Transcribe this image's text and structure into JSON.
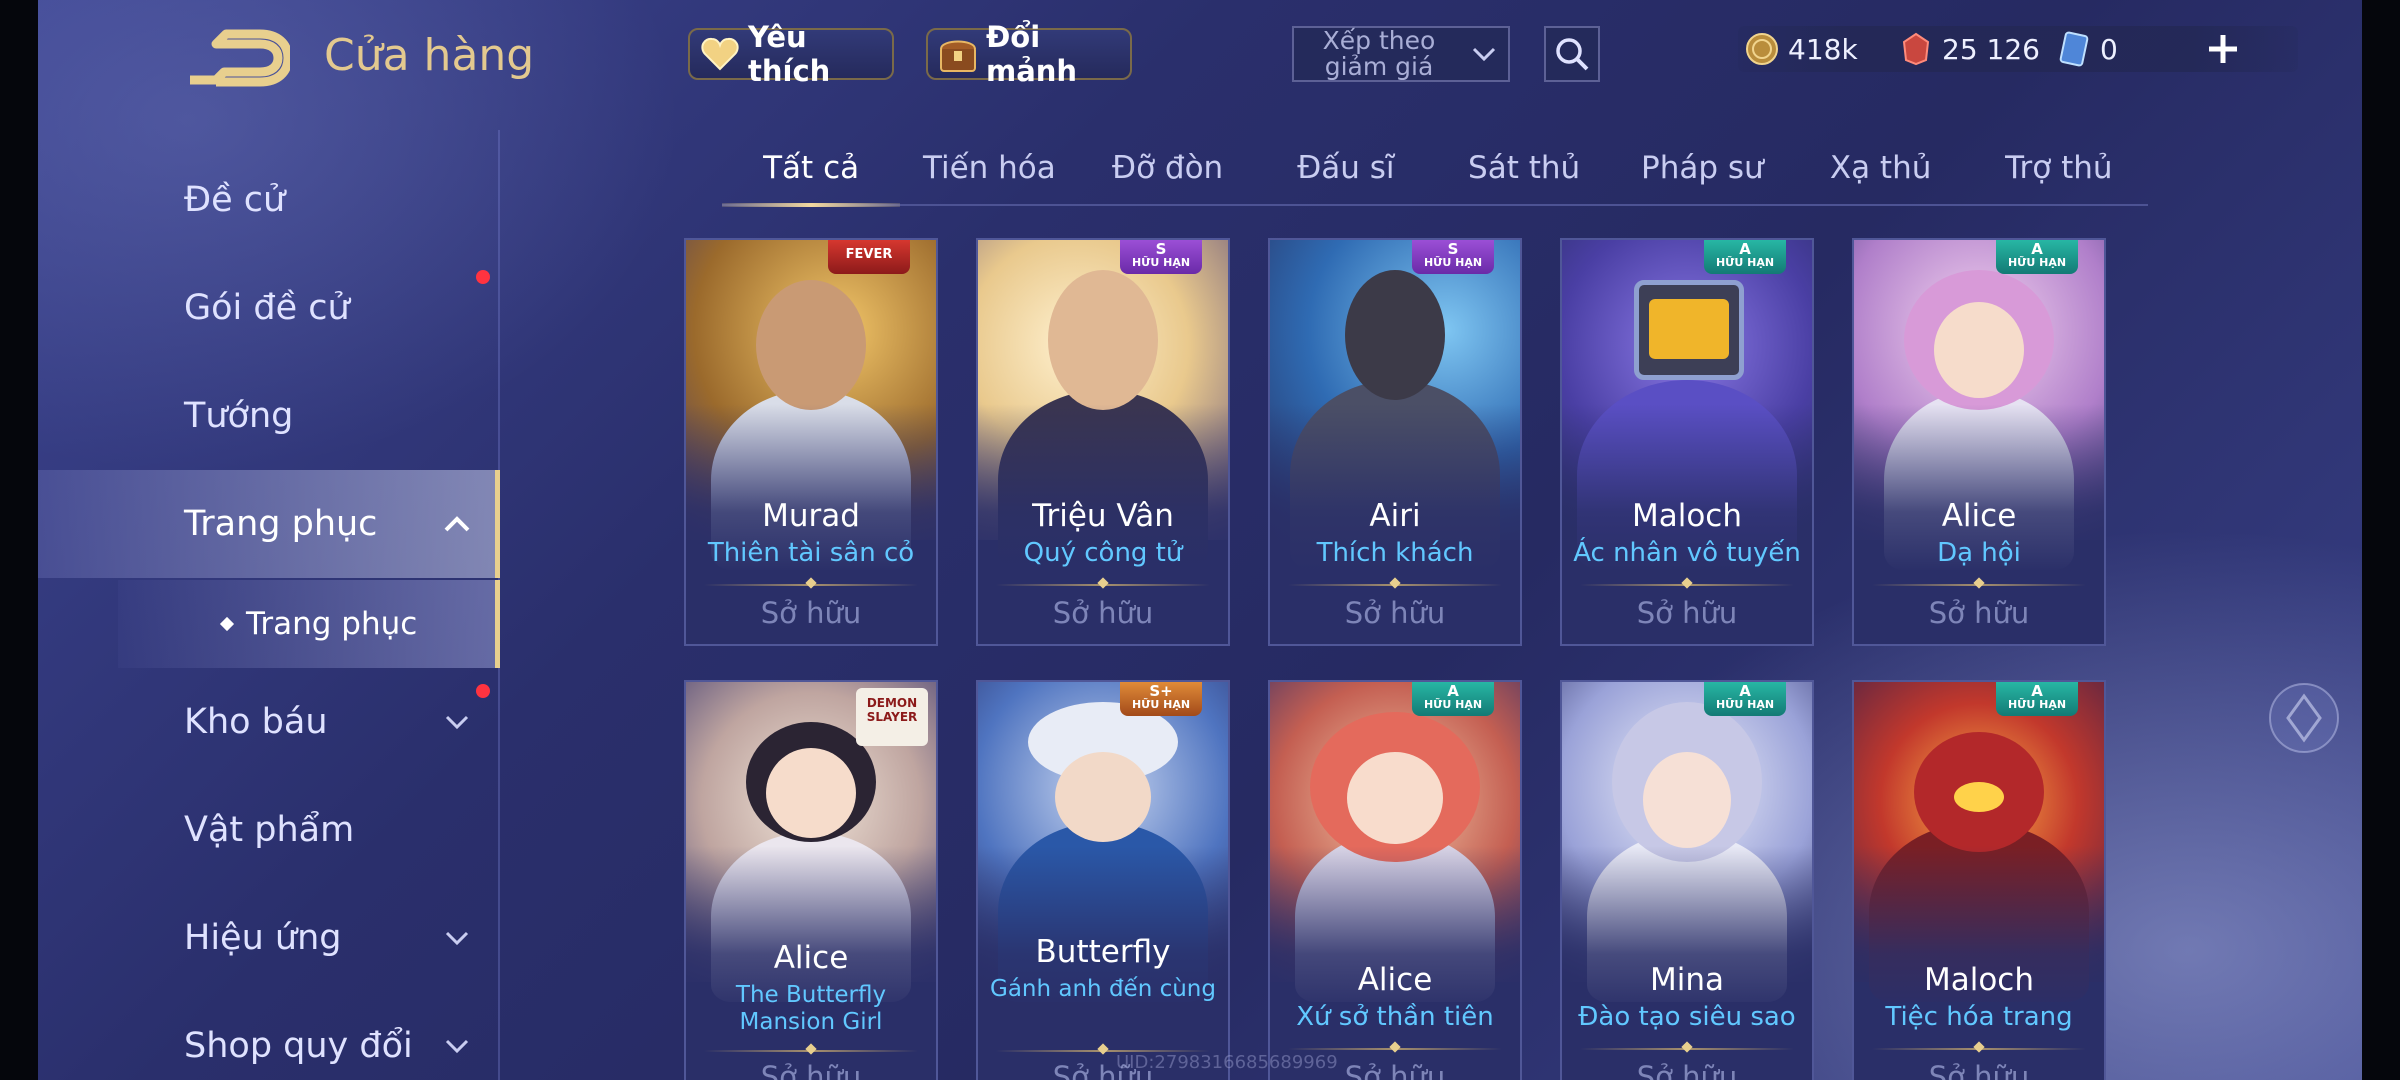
{
  "header": {
    "title": "Cửa hàng",
    "favorites_label": "Yêu thích",
    "shards_label": "Đổi mảnh",
    "sort_label": "Xếp theo giảm giá",
    "currencies": {
      "gold": "418k",
      "vouchers": "25 126",
      "rubies": "0"
    }
  },
  "sidebar": {
    "items": [
      {
        "label": "Đề cử"
      },
      {
        "label": "Gói đề cử"
      },
      {
        "label": "Tướng"
      },
      {
        "label": "Trang phục"
      },
      {
        "label": "Kho báu"
      },
      {
        "label": "Vật phẩm"
      },
      {
        "label": "Hiệu ứng"
      },
      {
        "label": "Shop quy đổi"
      }
    ],
    "sub_item": "Trang phục"
  },
  "tabs": [
    "Tất cả",
    "Tiến hóa",
    "Đỡ đòn",
    "Đấu sĩ",
    "Sát thủ",
    "Pháp sư",
    "Xạ thủ",
    "Trợ thủ"
  ],
  "skins": [
    {
      "hero": "Murad",
      "skin": "Thiên tài sân cỏ",
      "status": "Sở hữu",
      "badge": "FEVER",
      "accent": "#e0a447"
    },
    {
      "hero": "Triệu Vân",
      "skin": "Quý công tử",
      "status": "Sở hữu",
      "badge_tier": "S",
      "badge_text": "HỮU HẠN",
      "accent": "#d8b56a"
    },
    {
      "hero": "Airi",
      "skin": "Thích khách",
      "status": "Sở hữu",
      "badge_tier": "S",
      "badge_text": "HỮU HẠN",
      "accent": "#4a8bd2"
    },
    {
      "hero": "Maloch",
      "skin": "Ác nhân vô tuyến",
      "status": "Sở hữu",
      "badge_tier": "A",
      "badge_text": "HỮU HẠN",
      "accent": "#6a52c9"
    },
    {
      "hero": "Alice",
      "skin": "Dạ hội",
      "status": "Sở hữu",
      "badge_tier": "A",
      "badge_text": "HỮU HẠN",
      "accent": "#c98ad9"
    },
    {
      "hero": "Alice",
      "skin": "The Butterfly Mansion Girl",
      "status": "Sở hữu",
      "badge_logo": "DEMON SLAYER",
      "accent": "#c9a17a"
    },
    {
      "hero": "Butterfly",
      "skin": "Gánh anh đến cùng",
      "status": "Sở hữu",
      "badge_tier": "S+",
      "badge_text": "HỮU HẠN",
      "accent": "#3c6fc0"
    },
    {
      "hero": "Alice",
      "skin": "Xứ sở thần tiên",
      "status": "Sở hữu",
      "badge_tier": "A",
      "badge_text": "HỮU HẠN",
      "accent": "#d46a5a"
    },
    {
      "hero": "Mina",
      "skin": "Đào tạo siêu sao",
      "status": "Sở hữu",
      "badge_tier": "A",
      "badge_text": "HỮU HẠN",
      "accent": "#9aa2d8"
    },
    {
      "hero": "Maloch",
      "skin": "Tiệc hóa trang",
      "status": "Sở hữu",
      "badge_tier": "A",
      "badge_text": "HỮU HẠN",
      "accent": "#c2382c"
    }
  ],
  "watermark": "UID:2798316685689969",
  "colors": {
    "gold_accent": "#e8cf8e",
    "skin_name": "#61c8ff",
    "notification_dot": "#ff3340"
  }
}
